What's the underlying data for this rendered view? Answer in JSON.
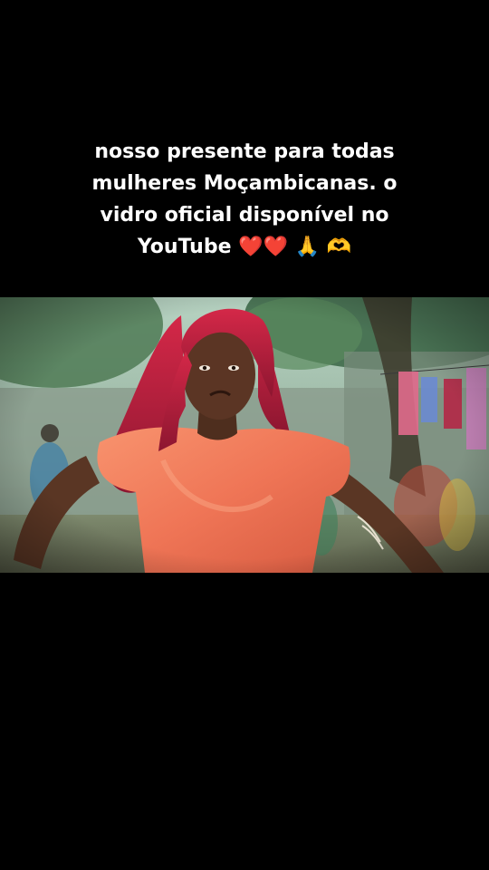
{
  "caption": {
    "line1": "nosso presente para todas",
    "line2": "mulheres Moçambicanas. o",
    "line3": "vidro oficial disponível no",
    "line4_text": "YouTube",
    "emoji": [
      "❤️",
      "❤️",
      "🙏",
      "🫶"
    ]
  },
  "colors": {
    "background": "#000000",
    "caption_text": "#ffffff",
    "dress": "#f07a5a",
    "hair": "#c01f3c",
    "heart": "#e0182a"
  },
  "video": {
    "subject": "woman-in-orange-dress-dancing"
  }
}
